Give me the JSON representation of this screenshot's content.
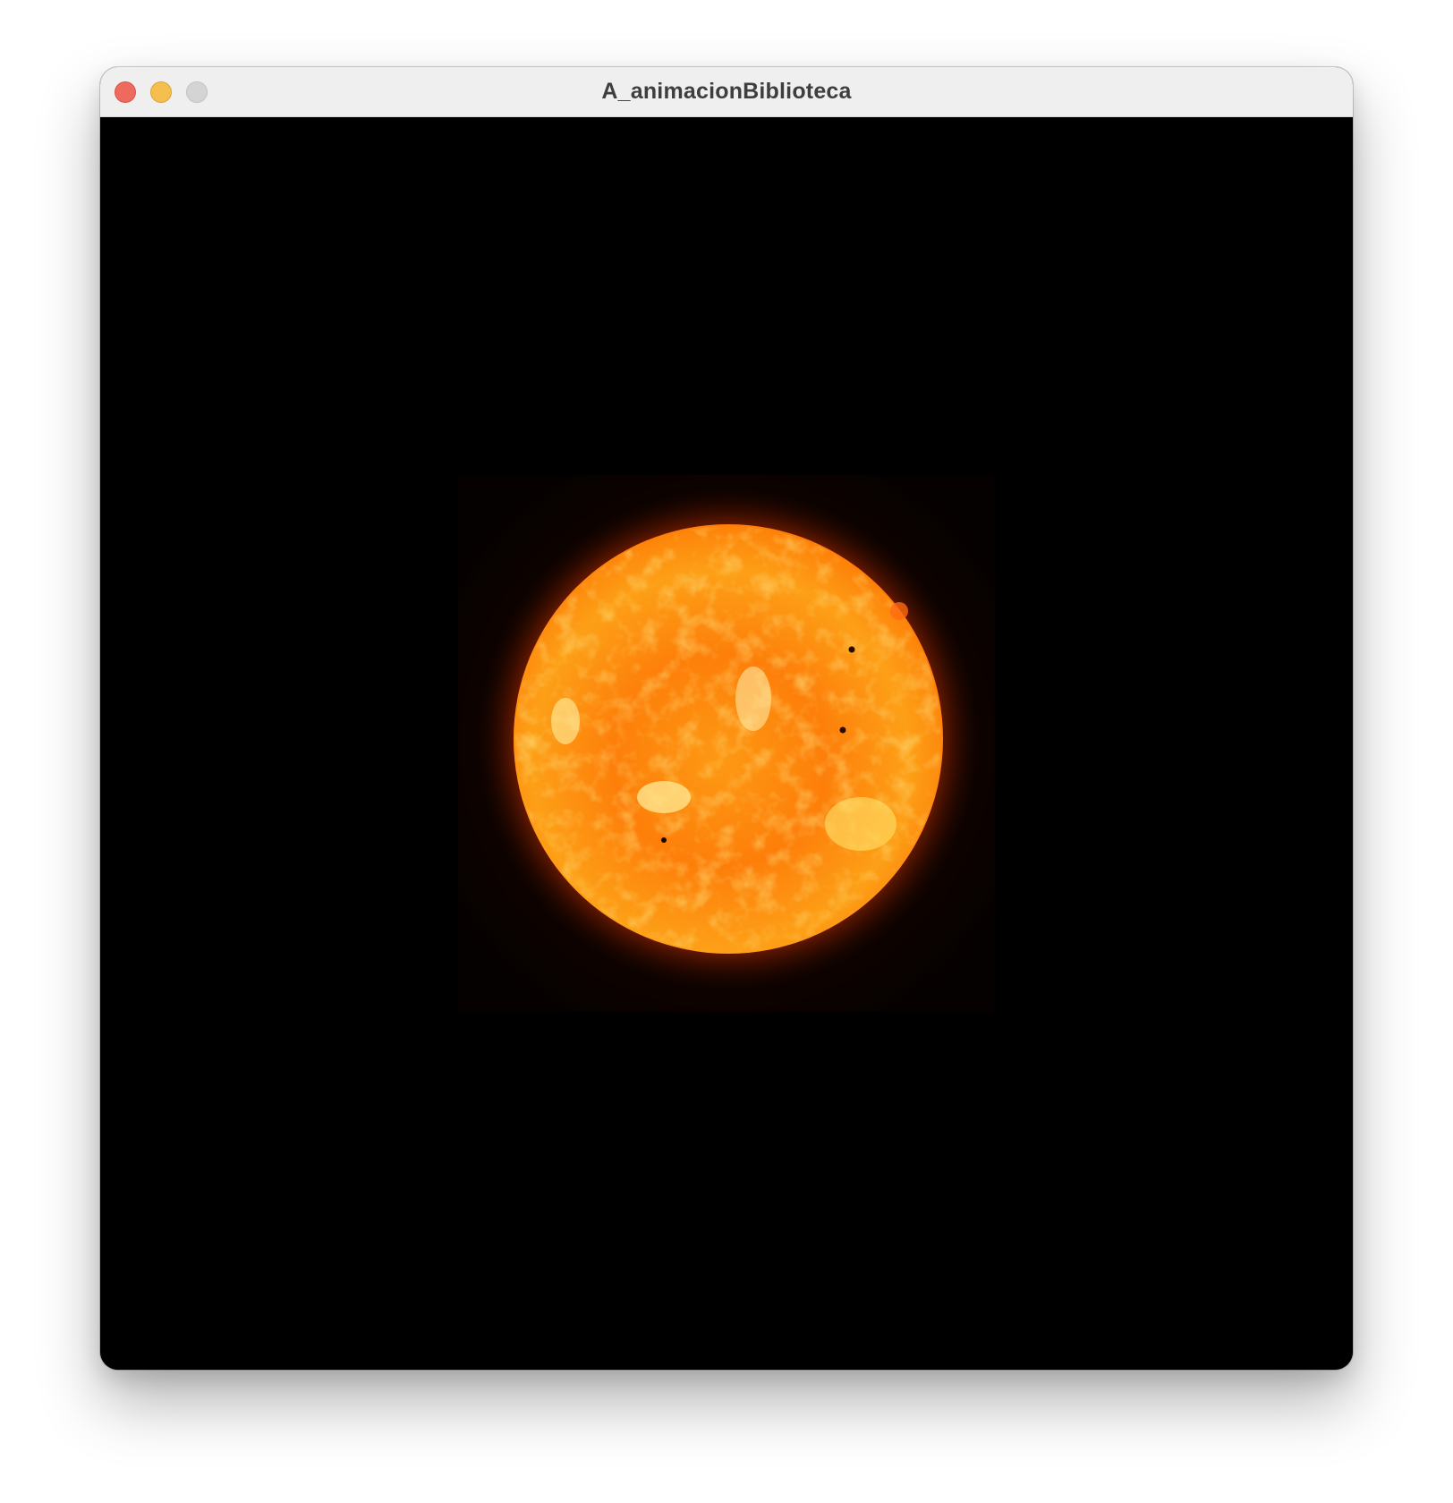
{
  "window": {
    "title": "A_animacionBiblioteca",
    "controls": [
      {
        "name": "close-button",
        "color": "#ee6a5e"
      },
      {
        "name": "minimize-button",
        "color": "#f5bf4f"
      },
      {
        "name": "zoom-button",
        "color": "#d4d4d4"
      }
    ]
  },
  "canvas": {
    "background": "#000000",
    "image": {
      "subject": "sun",
      "colors": {
        "core": "#ffd23a",
        "mid": "#ff8a10",
        "edge": "#e24a06",
        "corona": "#7a1c00"
      }
    }
  }
}
